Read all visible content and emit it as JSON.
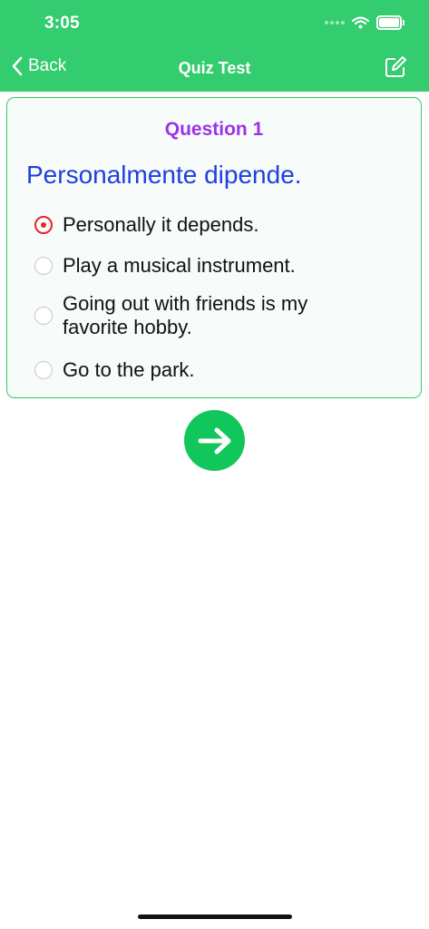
{
  "status_bar": {
    "time": "3:05"
  },
  "nav": {
    "back_label": "Back",
    "title": "Quiz Test"
  },
  "quiz": {
    "question_label": "Question 1",
    "question_text": "Personalmente dipende.",
    "options": [
      {
        "label": "Personally it depends.",
        "selected": true
      },
      {
        "label": "Play a musical instrument.",
        "selected": false
      },
      {
        "label": "Going out with friends is my favorite hobby.",
        "selected": false
      },
      {
        "label": "Go to the park.",
        "selected": false
      }
    ]
  },
  "colors": {
    "header_bg": "#33cc6e",
    "question_label": "#9a33e6",
    "question_text": "#1f3fe0",
    "selected_radio": "#e8242a",
    "next_button": "#11c65a"
  },
  "icons": {
    "back": "chevron-left-icon",
    "edit": "edit-square-icon",
    "next": "arrow-right-icon",
    "wifi": "wifi-icon",
    "battery": "battery-icon"
  }
}
